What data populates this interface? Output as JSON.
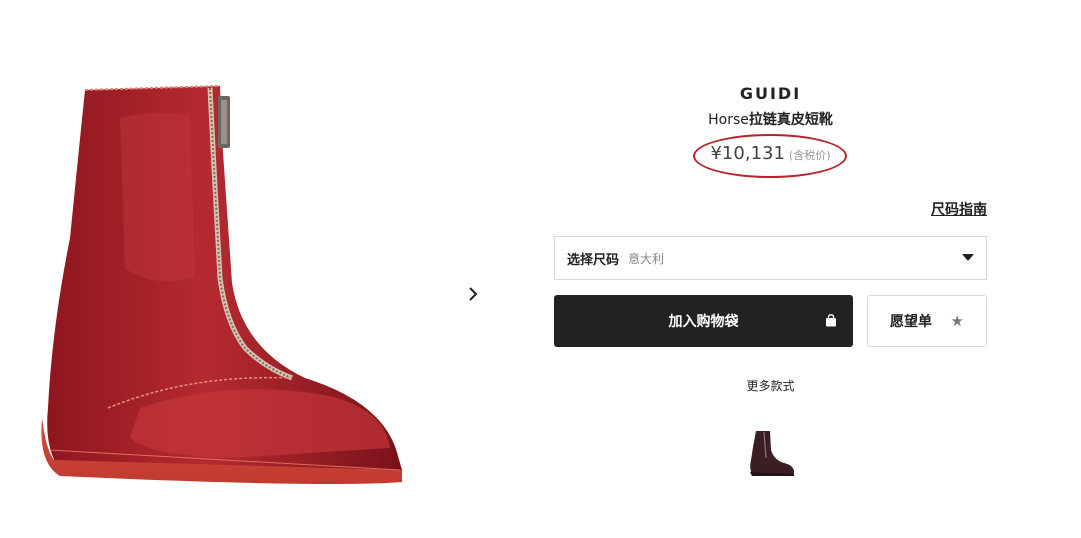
{
  "gallery": {
    "image_alt": "red leather zip boot",
    "next_icon": "chevron-right-icon"
  },
  "product": {
    "brand": "GUIDI",
    "name_latin": "Horse",
    "name_cjk": "拉链真皮短靴",
    "price": "¥10,131",
    "tax_note": "(含税价)"
  },
  "size_guide": {
    "label": "尺码指南"
  },
  "size_select": {
    "label": "选择尺码",
    "value": "意大利",
    "icon": "caret-down-icon"
  },
  "actions": {
    "add_to_bag": "加入购物袋",
    "bag_icon": "shopping-bag-icon",
    "wishlist": "愿望单",
    "wishlist_icon": "star-icon"
  },
  "more_styles": {
    "label": "更多款式"
  },
  "colors": {
    "accent_button": "#222222",
    "highlight_ring": "#b8232a",
    "boot_red": "#a01a22"
  }
}
